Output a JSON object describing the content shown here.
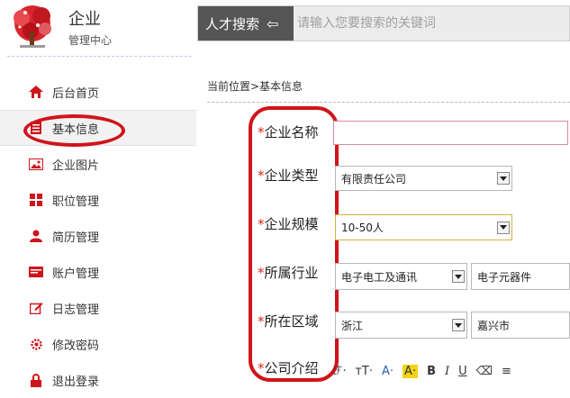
{
  "brand": {
    "name": "企业",
    "subtitle": "管理中心"
  },
  "search": {
    "label": "人才搜索",
    "placeholder": "请输入您要搜索的关键词"
  },
  "sidebar": {
    "items": [
      {
        "label": "后台首页",
        "icon": "home-icon"
      },
      {
        "label": "基本信息",
        "icon": "info-list-icon",
        "active": true
      },
      {
        "label": "企业图片",
        "icon": "image-icon"
      },
      {
        "label": "职位管理",
        "icon": "grid-icon"
      },
      {
        "label": "简历管理",
        "icon": "person-icon"
      },
      {
        "label": "账户管理",
        "icon": "card-icon"
      },
      {
        "label": "日志管理",
        "icon": "edit-icon"
      },
      {
        "label": "修改密码",
        "icon": "gear-icon"
      },
      {
        "label": "退出登录",
        "icon": "lock-icon"
      }
    ]
  },
  "breadcrumb": "当前位置>基本信息",
  "form": {
    "required_mark": "*",
    "labels": [
      "企业名称",
      "企业类型",
      "企业规模",
      "所属行业",
      "所在区域",
      "公司介绍"
    ],
    "company_type": "有限责任公司",
    "company_size": "10-50人",
    "industry_primary": "电子电工及通讯",
    "industry_secondary": "电子元器件",
    "region_province": "浙江",
    "region_city": "嘉兴市"
  },
  "editor_toolbar": [
    "ℱ·",
    "тT·",
    "A·",
    "A·",
    "B",
    "I",
    "U",
    "⌫",
    "≡"
  ],
  "colors": {
    "annotation": "#d0141b",
    "required": "#e0261b"
  }
}
